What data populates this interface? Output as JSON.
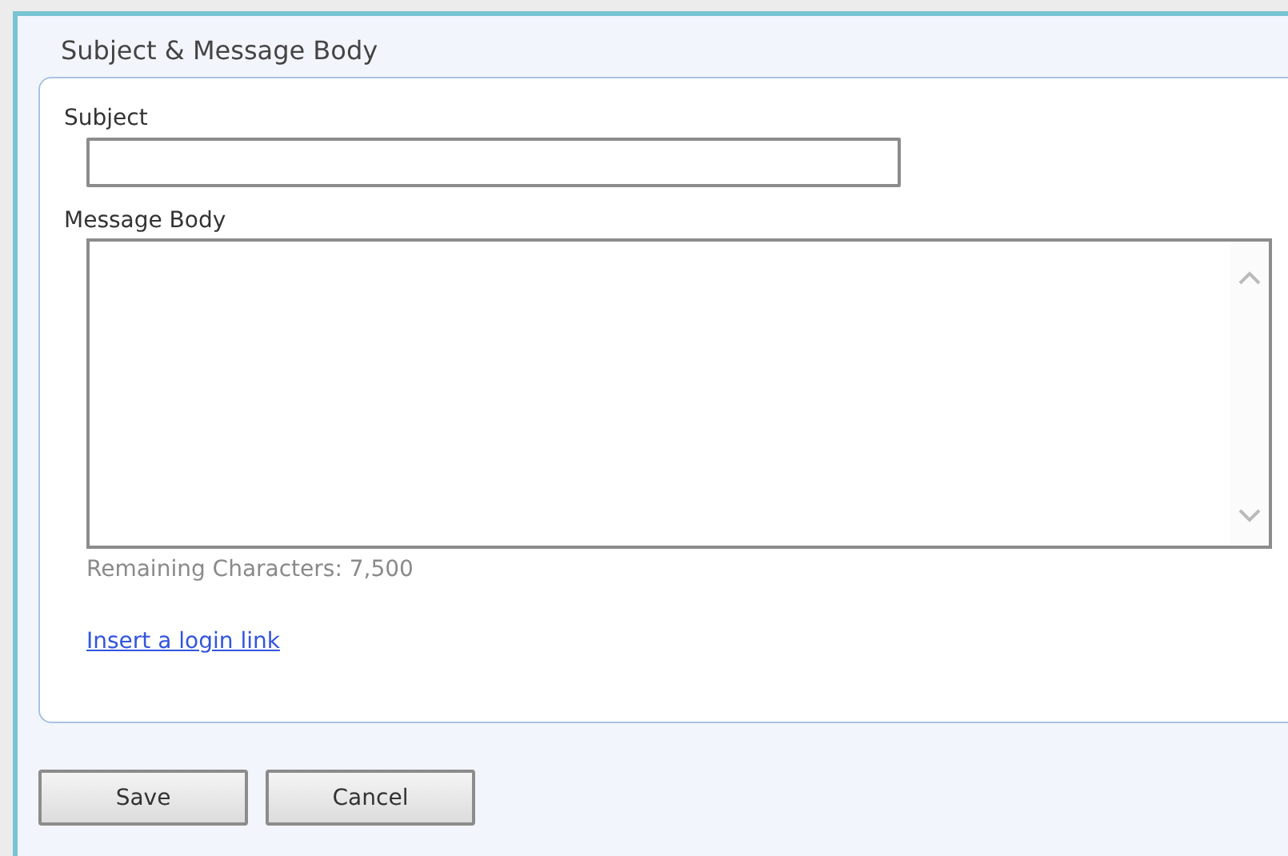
{
  "panel": {
    "title": "Subject & Message Body"
  },
  "subject": {
    "label": "Subject"
  },
  "message_body": {
    "label": "Message Body"
  },
  "remaining": "Remaining Characters: 7,500",
  "link": "Insert a login link",
  "buttons": [
    {
      "label": "Save"
    },
    {
      "label": "Cancel"
    }
  ]
}
